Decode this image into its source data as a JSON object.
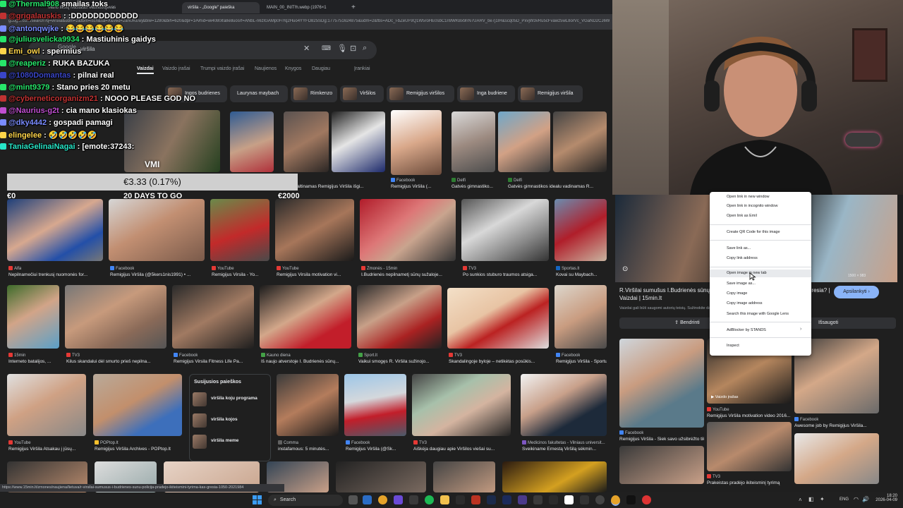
{
  "browser": {
    "tabs": [
      "Mano tikslų Mastatas Masilobojevas",
      "viršila - „Google\" paieška",
      "MAIN_00_INIT!h.webp (1976×1"
    ],
    "new_tab": "+",
    "url": "google.com/search?q=virsila&udm=2&tbm=isch&sa=X&ved=2ahUKEwj&biw=1280&bih=620&dpr=1#vhid=wi4080ifa8e8uosrf=ANbL-n6zIGAMp0FiYq2Huo4YYFD825SDg:1775751624875&udm=2&fbs=ADc_l-bZeUF9Q1W5roHE0sbC1n9WKBx9nN7UARV_be7j1IH&scq05D_PxvjW3vRu5cFvawz5wL8orVc_VGaND2CJ6WVk6fjd6iTzXR"
  },
  "search": {
    "query": "viršila",
    "logo": "Google"
  },
  "nav_tabs": [
    "Vaizdai",
    "Vaizdo įrašai",
    "Trumpi vaizdo įrašai",
    "Naujienos",
    "Knygos",
    "Daugiau",
    "Įrankiai"
  ],
  "chips": [
    "Ingos budrienes",
    "Laurynas maybach",
    "Rimkenzo",
    "Viršilos",
    "Remigijus viršilos",
    "Inga budriene",
    "Remigijus viršila"
  ],
  "row2": [
    {
      "caption": "Nepilnamečiui trenkusį nuomonės for...",
      "source": "Alfa"
    },
    {
      "caption": "Remigijus Viršila (@5kers1nis1991) • ...",
      "source": "Facebook"
    },
    {
      "caption": "Remigijus Virsila - Yo...",
      "source": "YouTube"
    },
    {
      "caption": "Remigijus Virsila motivation vi...",
      "source": "YouTube"
    },
    {
      "caption": "I.Budrienės nepilnametį sūnų sužaloje...",
      "source": "Žmonės - 15min"
    },
    {
      "caption": "Po sunkios stuburo traumos atsiga...",
      "source": "TV3"
    },
    {
      "caption": "Kovai su Maybach...",
      "source": "Sportas.lt"
    }
  ],
  "row1_captions": [
    {
      "caption": "Kilus kaltinamas Remigijus Viršila išgi...",
      "source": ""
    },
    {
      "caption": "Remigijus Viršila (...",
      "source": "Facebook"
    },
    {
      "caption": "Gatvės gimnastiko...",
      "source": "Delfi"
    },
    {
      "caption": "Gatvės gimnastikos idealu vadinamas R...",
      "source": "Delfi"
    }
  ],
  "row3": [
    {
      "caption": "Interneto batalijos, ...",
      "source": "15min"
    },
    {
      "caption": "Kilus skandalui dėl smurto prieš nepilna...",
      "source": "TV3"
    },
    {
      "caption": "Remigijus Virsila Fitness Life Pa...",
      "source": "Facebook"
    },
    {
      "caption": "Iš naujo atverstoje I. Budrienės sūnų...",
      "source": "Kauno diena"
    },
    {
      "caption": "Vaikui smogęs R. Viršila sužinojo...",
      "source": "Sport.lt"
    },
    {
      "caption": "Skandalingoje byloje – netikėtas posūkis...",
      "source": "TV3"
    },
    {
      "caption": "Remigijus Viršila - Sportu...",
      "source": "Facebook"
    }
  ],
  "row4": [
    {
      "caption": "Remigijus Viršila Atsakau į jūsų...",
      "source": "YouTube"
    },
    {
      "caption": "Remigijus Viršila Archives - POPtop.lt",
      "source": "POPtop.lt"
    },
    {
      "caption": "instafamous: 5 minutės...",
      "source": "Comma"
    },
    {
      "caption": "Remigijus Viršila (@Sk...",
      "source": "Facebook"
    },
    {
      "caption": "Aiškėja daugiau apie Viršilos viešai su...",
      "source": "TV3"
    },
    {
      "caption": "Sveikiname Ernestą Viršilą sėkmin...",
      "source": "Medicinos fakultetas - Vilniaus universit..."
    }
  ],
  "related": {
    "title": "Susijusios paieškos",
    "items": [
      "viršila koju programa",
      "viršila kojos",
      "viršila meme"
    ]
  },
  "chat": [
    {
      "user": "@Thermal908",
      "msg": "smailas toks",
      "color": "#27e66a"
    },
    {
      "user": "@grigalauskis",
      "msg": ": :DDDDDDDDDDDD",
      "color": "#c03232"
    },
    {
      "user": "@antonqwjke",
      "msg": ": 😂😂😂😂😂😂",
      "color": "#7a8cff"
    },
    {
      "user": "@juliusvelicka9934",
      "msg": ": Mastiuhinis gaidys",
      "color": "#27e66a"
    },
    {
      "user": "Emi_owl",
      "msg": ": spermius",
      "color": "#ffd54a"
    },
    {
      "user": "@reaperiz",
      "msg": ": RUKA BAZUKA",
      "color": "#27e66a"
    },
    {
      "user": "@1080Domantas",
      "msg": ": pilnai real",
      "color": "#3a46c8"
    },
    {
      "user": "@mint9379",
      "msg": ": Stano pries 20 metu",
      "color": "#27e66a"
    },
    {
      "user": "@cyberneticorganizm21",
      "msg": ": NOOO PLEASE GOD NO",
      "color": "#c03232"
    },
    {
      "user": "@Naurius-g2t",
      "msg": ": cia mano klasiokas",
      "color": "#c04fd0"
    },
    {
      "user": "@dky4442",
      "msg": ": gospadi pamagi",
      "color": "#7a8cff"
    },
    {
      "user": "elingelee",
      "msg": ": 🤣🤣🤣🤣🤣",
      "color": "#ffd54a"
    },
    {
      "user": "TaniaGelinaiNagai",
      "msg": ": [emote:37243:",
      "color": "#27e6c8"
    }
  ],
  "donation": "€3.33 (0.17%)",
  "goals": [
    "€0",
    "20 DAYS TO GO",
    "€2000"
  ],
  "overlay_text": "VMI",
  "right_panel": {
    "title": "R.Viršilai sumušus I.Budrienės sūnų policija pradėjo ikiteisminį tyrimą – kas gresia? | Vaizdai | 15min.lt",
    "note": "Vaizdai gali būti saugomi autorių teisių. Sužinokite daugiau",
    "visit_button": "Apsilankyti",
    "share_button": "Bendrinti",
    "save_button": "Išsaugoti",
    "dims": "1500 × 983",
    "grid": [
      {
        "caption": "Remigijus Viršila - Siek savo užsibrėžto tikslo! ...",
        "source": "Facebook"
      },
      {
        "caption": "Remigijus Viršila motivation video 2016...",
        "source": "YouTube"
      },
      {
        "caption": "Awesome job by Remigijus Viršila...",
        "source": "Facebook"
      },
      {
        "caption": "Prakeistas pradėjo ikiteisminį tyrimą",
        "source": "TV3"
      }
    ],
    "video_label": "Vaizdo įrašas"
  },
  "context_menu": {
    "items": [
      "Open link in new window",
      "Open link in incognito window",
      "Open link as Emil",
      "Create QR Code for this image",
      "Save link as...",
      "Copy link address",
      "Open image in new tab",
      "Save image as...",
      "Copy image",
      "Copy image address",
      "Search this image with Google Lens",
      "AdBlocker by STANDS",
      "Inspect"
    ],
    "highlighted_index": 6
  },
  "status_url": "https://www.15min.lt/zmones/naujiena/lietuva/r-virsilai-sumusus-i-budrienes-sunu-policija-pradejo-ikiteismini-tyrima-kas-gresia-1050-2021984",
  "taskbar": {
    "search": "Search",
    "lang": "ENG",
    "time": "18:20",
    "date": "2026-04-09"
  }
}
